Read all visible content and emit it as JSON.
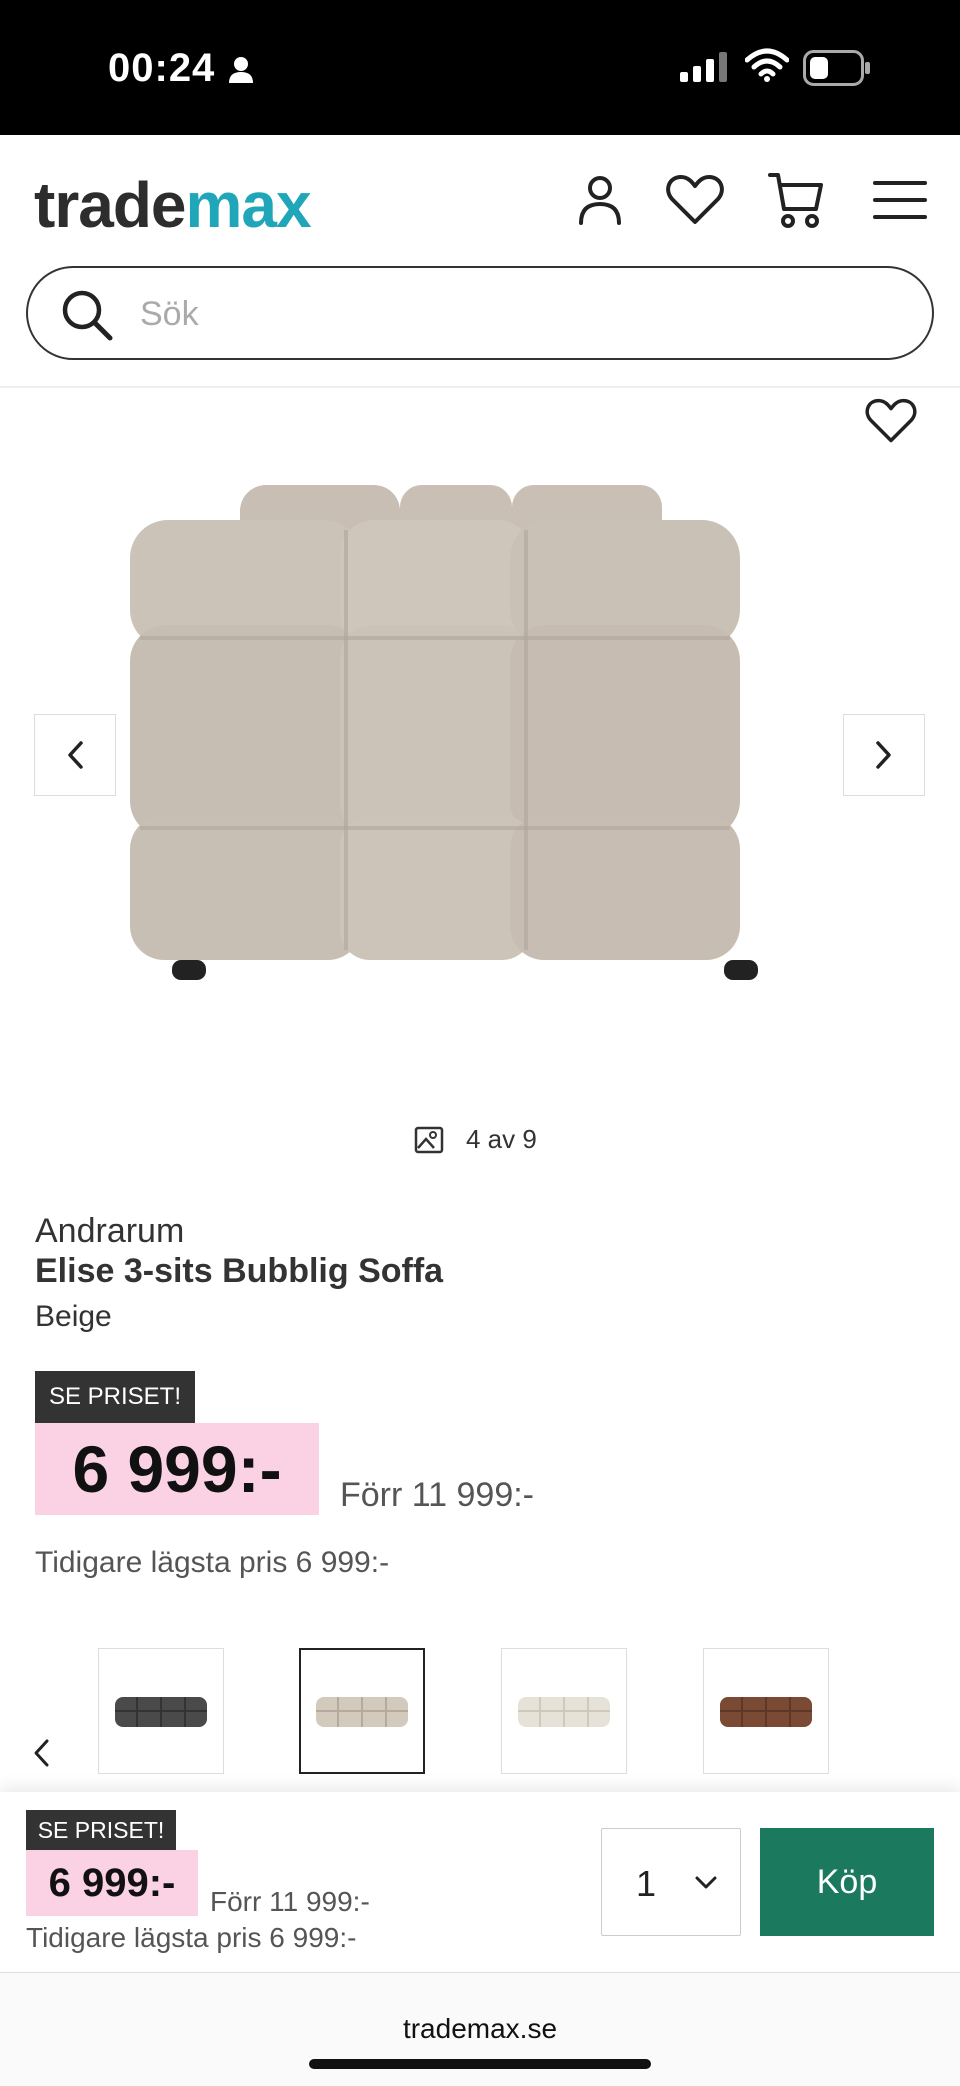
{
  "status_bar": {
    "time": "00:24"
  },
  "header": {
    "logo": {
      "part1": "trade",
      "part2": "max"
    },
    "search": {
      "placeholder": "Sök"
    }
  },
  "gallery": {
    "counter": "4 av 9"
  },
  "product": {
    "brand": "Andrarum",
    "title": "Elise 3-sits Bubblig Soffa",
    "variant": "Beige",
    "badge": "SE PRISET!",
    "price": "6 999:-",
    "old_price": "Förr 11 999:-",
    "lowest_price": "Tidigare lägsta pris 6 999:-",
    "colors": [
      {
        "name": "dark-grey",
        "hex": "#4a4a4a"
      },
      {
        "name": "beige",
        "hex": "#d3c9bd"
      },
      {
        "name": "cream",
        "hex": "#e7e2d8"
      },
      {
        "name": "brown",
        "hex": "#7a4a34"
      }
    ]
  },
  "buy_bar": {
    "badge": "SE PRISET!",
    "price": "6 999:-",
    "old_price": "Förr 11 999:-",
    "lowest_price": "Tidigare lägsta pris 6 999:-",
    "quantity": "1",
    "buy_label": "Köp"
  },
  "browser": {
    "url": "trademax.se"
  },
  "colors": {
    "accent": "#1b7a5d",
    "price_bg": "#fbd1e4",
    "logo_teal": "#1fa6b8"
  }
}
